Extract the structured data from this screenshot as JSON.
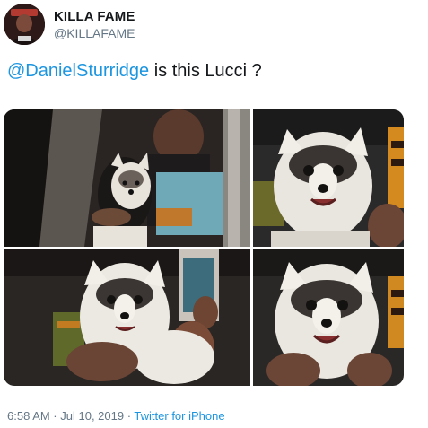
{
  "tweet": {
    "author_name": "KILLA FAME",
    "author_handle": "@KILLAFAME",
    "mention": "@DanielSturridge",
    "text_rest": " is this Lucci ?",
    "timestamp": "6:58 AM · Jul 10, 2019",
    "separator": " · ",
    "source": "Twitter for iPhone"
  },
  "colors": {
    "link": "#1b95e0",
    "secondary_text": "#657786",
    "primary_text": "#14171a"
  },
  "media": {
    "photos": [
      {
        "description": "dog-held-by-person-in-car"
      },
      {
        "description": "dog-closeup-smiling"
      },
      {
        "description": "dog-held-on-lap"
      },
      {
        "description": "dog-closeup-smiling-2"
      }
    ]
  }
}
